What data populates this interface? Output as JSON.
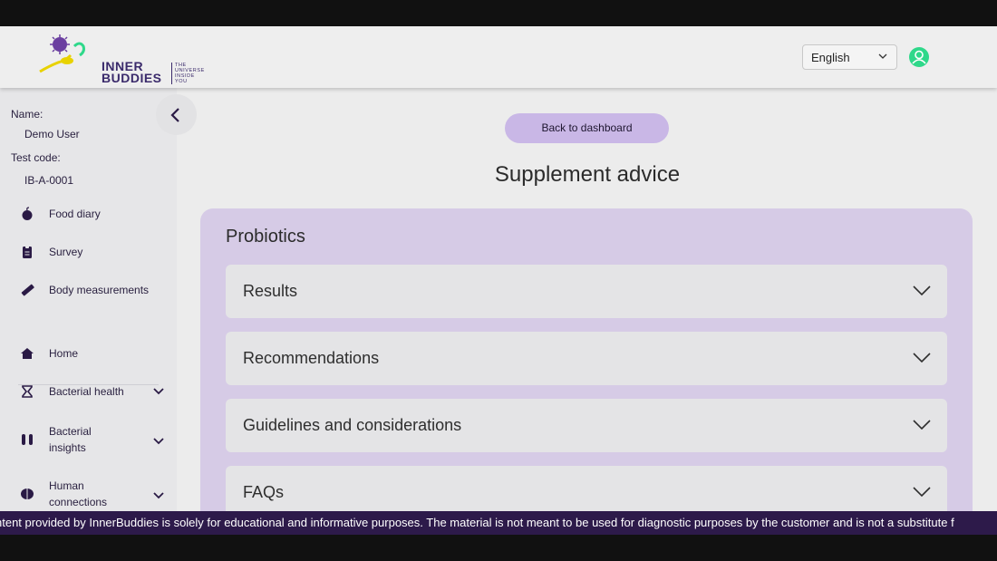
{
  "header": {
    "logo_text_line1": "INNER",
    "logo_text_line2": "BUDDIES",
    "logo_tagline": "THE UNIVERSE INSIDE YOU",
    "language": "English",
    "avatar_icon": "user-circle-icon",
    "avatar_color": "#2fd88a"
  },
  "sidebar": {
    "name_label": "Name:",
    "name_value": "Demo User",
    "test_code_label": "Test code:",
    "test_code_value": "IB-A-0001",
    "top_items": [
      {
        "label": "Food diary",
        "icon": "apple-icon"
      },
      {
        "label": "Survey",
        "icon": "clipboard-icon"
      },
      {
        "label": "Body measurements",
        "icon": "ruler-icon"
      }
    ],
    "nav_items": [
      {
        "label": "Home",
        "icon": "home-icon"
      },
      {
        "label": "Bacterial health",
        "icon": "hourglass-icon"
      },
      {
        "label": "Bacterial insights",
        "icon": "test-tubes-icon"
      },
      {
        "label": "Human connections",
        "icon": "brain-icon"
      }
    ]
  },
  "main": {
    "back_button": "Back to dashboard",
    "page_title": "Supplement advice",
    "section_title": "Probiotics",
    "accordions": [
      {
        "label": "Results"
      },
      {
        "label": "Recommendations"
      },
      {
        "label": "Guidelines and considerations"
      },
      {
        "label": "FAQs"
      }
    ]
  },
  "ticker": {
    "text": "ntent provided by InnerBuddies is solely for educational and informative purposes. The material is not meant to be used for diagnostic purposes by the customer and is not a substitute f"
  },
  "colors": {
    "accent": "#c9b7e6",
    "panel": "#d6cbe6",
    "ticker_bg": "#2d1a4a",
    "brand_dark": "#3a2a6b"
  }
}
